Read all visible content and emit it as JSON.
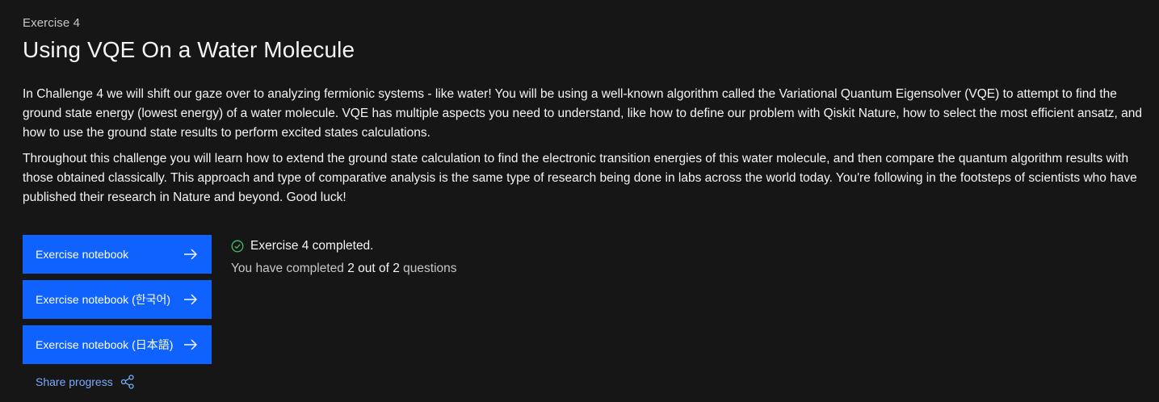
{
  "exercise": {
    "eyebrow": "Exercise 4",
    "title": "Using VQE On a Water Molecule"
  },
  "description": {
    "paragraph1": "In Challenge 4 we will shift our gaze over to analyzing fermionic systems - like water! You will be using a well-known algorithm called the Variational Quantum Eigensolver (VQE) to attempt to find the ground state energy (lowest energy) of a water molecule. VQE has multiple aspects you need to understand, like how to define our problem with Qiskit Nature, how to select the most efficient ansatz, and how to use the ground state results to perform excited states calculations.",
    "paragraph2": "Throughout this challenge you will learn how to extend the ground state calculation to find the electronic transition energies of this water molecule, and then compare the quantum algorithm results with those obtained classically. This approach and type of comparative analysis is the same type of research being done in labs across the world today. You're following in the footsteps of scientists who have published their research in Nature and beyond. Good luck!"
  },
  "buttons": {
    "notebook": "Exercise notebook",
    "notebook_ko": "Exercise notebook (한국어)",
    "notebook_ja": "Exercise notebook (日本語)"
  },
  "share": {
    "label": "Share progress",
    "icon": "share-icon"
  },
  "status": {
    "icon": "checkmark-outline-icon",
    "text": "Exercise 4 completed.",
    "progress_prefix": "You have completed",
    "progress_count": "2 out of 2",
    "progress_suffix": "questions"
  },
  "colors": {
    "background": "#161616",
    "primary_button": "#0f62fe",
    "link": "#78a9ff",
    "success": "#42be65"
  }
}
